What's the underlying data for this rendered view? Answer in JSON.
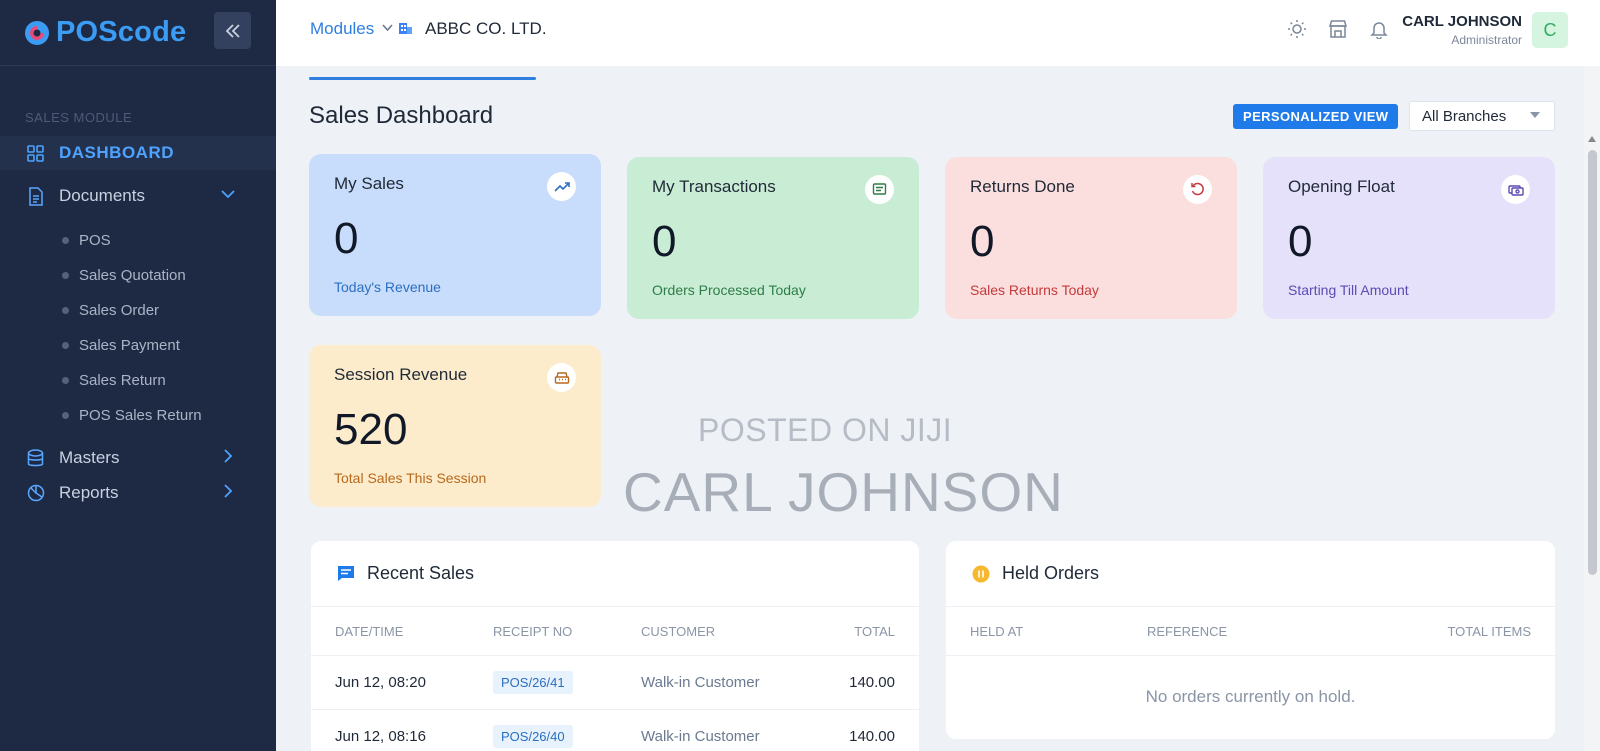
{
  "sidebar": {
    "brand": "POScode",
    "section_label": "SALES MODULE",
    "nav": {
      "dashboard": "DASHBOARD",
      "documents": "Documents",
      "masters": "Masters",
      "reports": "Reports"
    },
    "documents_children": [
      "POS",
      "Sales Quotation",
      "Sales Order",
      "Sales Payment",
      "Sales Return",
      "POS Sales Return"
    ]
  },
  "topbar": {
    "modules_label": "Modules",
    "company": "ABBC CO. LTD.",
    "user_name": "CARL JOHNSON",
    "user_role": "Administrator",
    "avatar_initial": "C"
  },
  "page": {
    "title": "Sales Dashboard",
    "personalized_view": "PERSONALIZED VIEW",
    "branch_selected": "All Branches"
  },
  "cards": [
    {
      "title": "My Sales",
      "value": "0",
      "subtitle": "Today's Revenue",
      "bg": "#c8dcfb",
      "sub_color": "#2c6fc2",
      "icon": "trend-up-icon"
    },
    {
      "title": "My Transactions",
      "value": "0",
      "subtitle": "Orders Processed Today",
      "bg": "#c9ecd4",
      "sub_color": "#2e7d47",
      "icon": "receipt-icon"
    },
    {
      "title": "Returns Done",
      "value": "0",
      "subtitle": "Sales Returns Today",
      "bg": "#fbdede",
      "sub_color": "#c53b3b",
      "icon": "undo-icon"
    },
    {
      "title": "Opening Float",
      "value": "0",
      "subtitle": "Starting Till Amount",
      "bg": "#e6e1fb",
      "sub_color": "#5b4bb3",
      "icon": "cash-icon"
    },
    {
      "title": "Session Revenue",
      "value": "520",
      "subtitle": "Total Sales This Session",
      "bg": "#fdeccb",
      "sub_color": "#b7691d",
      "icon": "register-icon"
    }
  ],
  "watermark": {
    "line1": "POSTED ON JIJI",
    "line2": "CARL JOHNSON"
  },
  "recent_sales": {
    "title": "Recent Sales",
    "columns": [
      "DATE/TIME",
      "RECEIPT NO",
      "CUSTOMER",
      "TOTAL"
    ],
    "rows": [
      {
        "datetime": "Jun 12, 08:20",
        "receipt": "POS/26/41",
        "customer": "Walk-in Customer",
        "total": "140.00"
      },
      {
        "datetime": "Jun 12, 08:16",
        "receipt": "POS/26/40",
        "customer": "Walk-in Customer",
        "total": "140.00"
      }
    ]
  },
  "held_orders": {
    "title": "Held Orders",
    "columns": [
      "HELD AT",
      "REFERENCE",
      "TOTAL ITEMS"
    ],
    "empty_message": "No orders currently on hold."
  }
}
